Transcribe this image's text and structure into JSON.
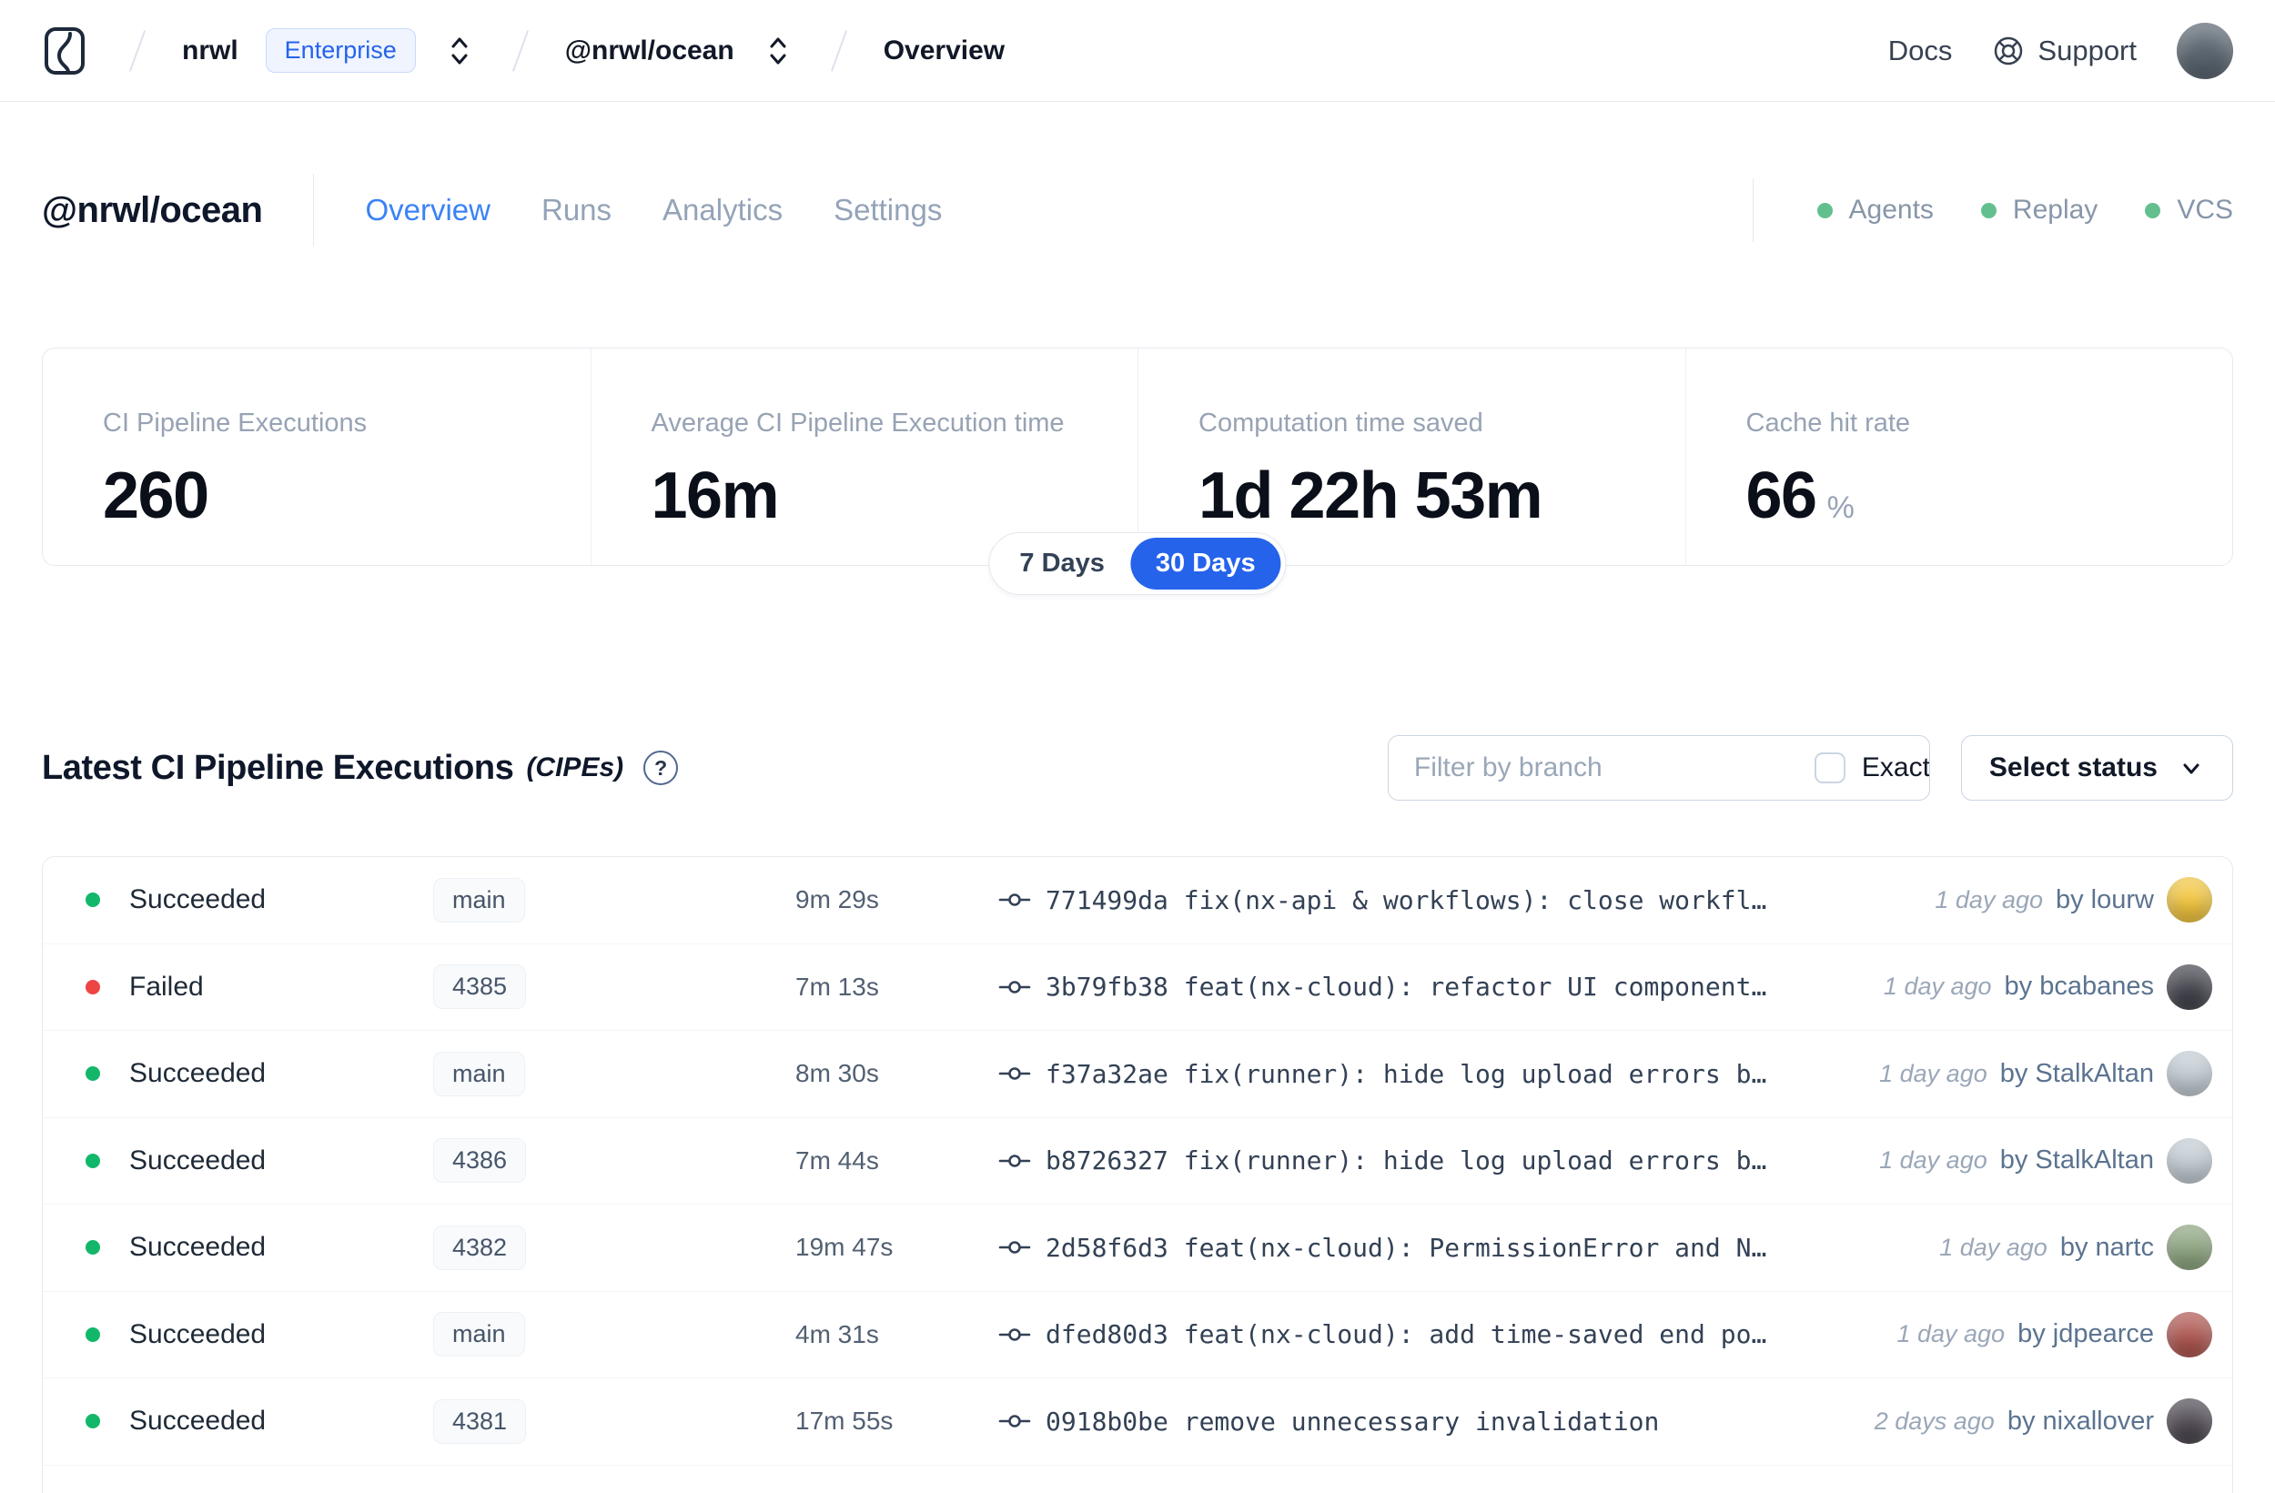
{
  "navbar": {
    "org": "nrwl",
    "org_badge": "Enterprise",
    "workspace": "@nrwl/ocean",
    "page": "Overview",
    "docs_label": "Docs",
    "support_label": "Support",
    "avatar_color": "#59646F"
  },
  "header": {
    "title": "@nrwl/ocean",
    "tabs": [
      {
        "label": "Overview",
        "active": true
      },
      {
        "label": "Runs",
        "active": false
      },
      {
        "label": "Analytics",
        "active": false
      },
      {
        "label": "Settings",
        "active": false
      }
    ],
    "status_items": [
      "Agents",
      "Replay",
      "VCS"
    ]
  },
  "stats": {
    "cards": [
      {
        "label": "CI Pipeline Executions",
        "value": "260"
      },
      {
        "label": "Average CI Pipeline Execution time",
        "value": "16m"
      },
      {
        "label": "Computation time saved",
        "value": "1d 22h 53m"
      },
      {
        "label": "Cache hit rate",
        "value": "66",
        "unit": "%"
      }
    ],
    "range_toggle": {
      "options": [
        "7 Days",
        "30 Days"
      ],
      "selected": "30 Days"
    }
  },
  "cipe_section": {
    "title": "Latest CI Pipeline Executions",
    "title_suffix": "(CIPEs)",
    "help_glyph": "?",
    "filter_placeholder": "Filter by branch",
    "exact_label": "Exact",
    "exact_checked": false,
    "status_select_label": "Select status",
    "rows": [
      {
        "status": "Succeeded",
        "branch": "main",
        "duration": "9m 29s",
        "commit": "771499da fix(nx-api & workflows): close workfl…",
        "time": "1 day ago",
        "author": "by lourw",
        "avatar_color": "#F2C53D"
      },
      {
        "status": "Failed",
        "branch": "4385",
        "duration": "7m 13s",
        "commit": "3b79fb38 feat(nx-cloud): refactor UI component…",
        "time": "1 day ago",
        "author": "by bcabanes",
        "avatar_color": "#41414B"
      },
      {
        "status": "Succeeded",
        "branch": "main",
        "duration": "8m 30s",
        "commit": "f37a32ae fix(runner): hide log upload errors b…",
        "time": "1 day ago",
        "author": "by StalkAltan",
        "avatar_color": "#C2CCD4"
      },
      {
        "status": "Succeeded",
        "branch": "4386",
        "duration": "7m 44s",
        "commit": "b8726327 fix(runner): hide log upload errors b…",
        "time": "1 day ago",
        "author": "by StalkAltan",
        "avatar_color": "#C2CCD4"
      },
      {
        "status": "Succeeded",
        "branch": "4382",
        "duration": "19m 47s",
        "commit": "2d58f6d3 feat(nx-cloud): PermissionError and N…",
        "time": "1 day ago",
        "author": "by nartc",
        "avatar_color": "#8CA47E"
      },
      {
        "status": "Succeeded",
        "branch": "main",
        "duration": "4m 31s",
        "commit": "dfed80d3 feat(nx-cloud): add time-saved end po…",
        "time": "1 day ago",
        "author": "by jdpearce",
        "avatar_color": "#AE544E"
      },
      {
        "status": "Succeeded",
        "branch": "4381",
        "duration": "17m 55s",
        "commit": "0918b0be remove unnecessary invalidation",
        "time": "2 days ago",
        "author": "by nixallover",
        "avatar_color": "#4C4650"
      }
    ]
  },
  "colors": {
    "succeeded_dot": "#12B76A",
    "failed_dot": "#EF4444",
    "header_dot": "#63C08E",
    "accent_blue": "#2563EB",
    "tab_active_blue": "#3B82F6"
  }
}
